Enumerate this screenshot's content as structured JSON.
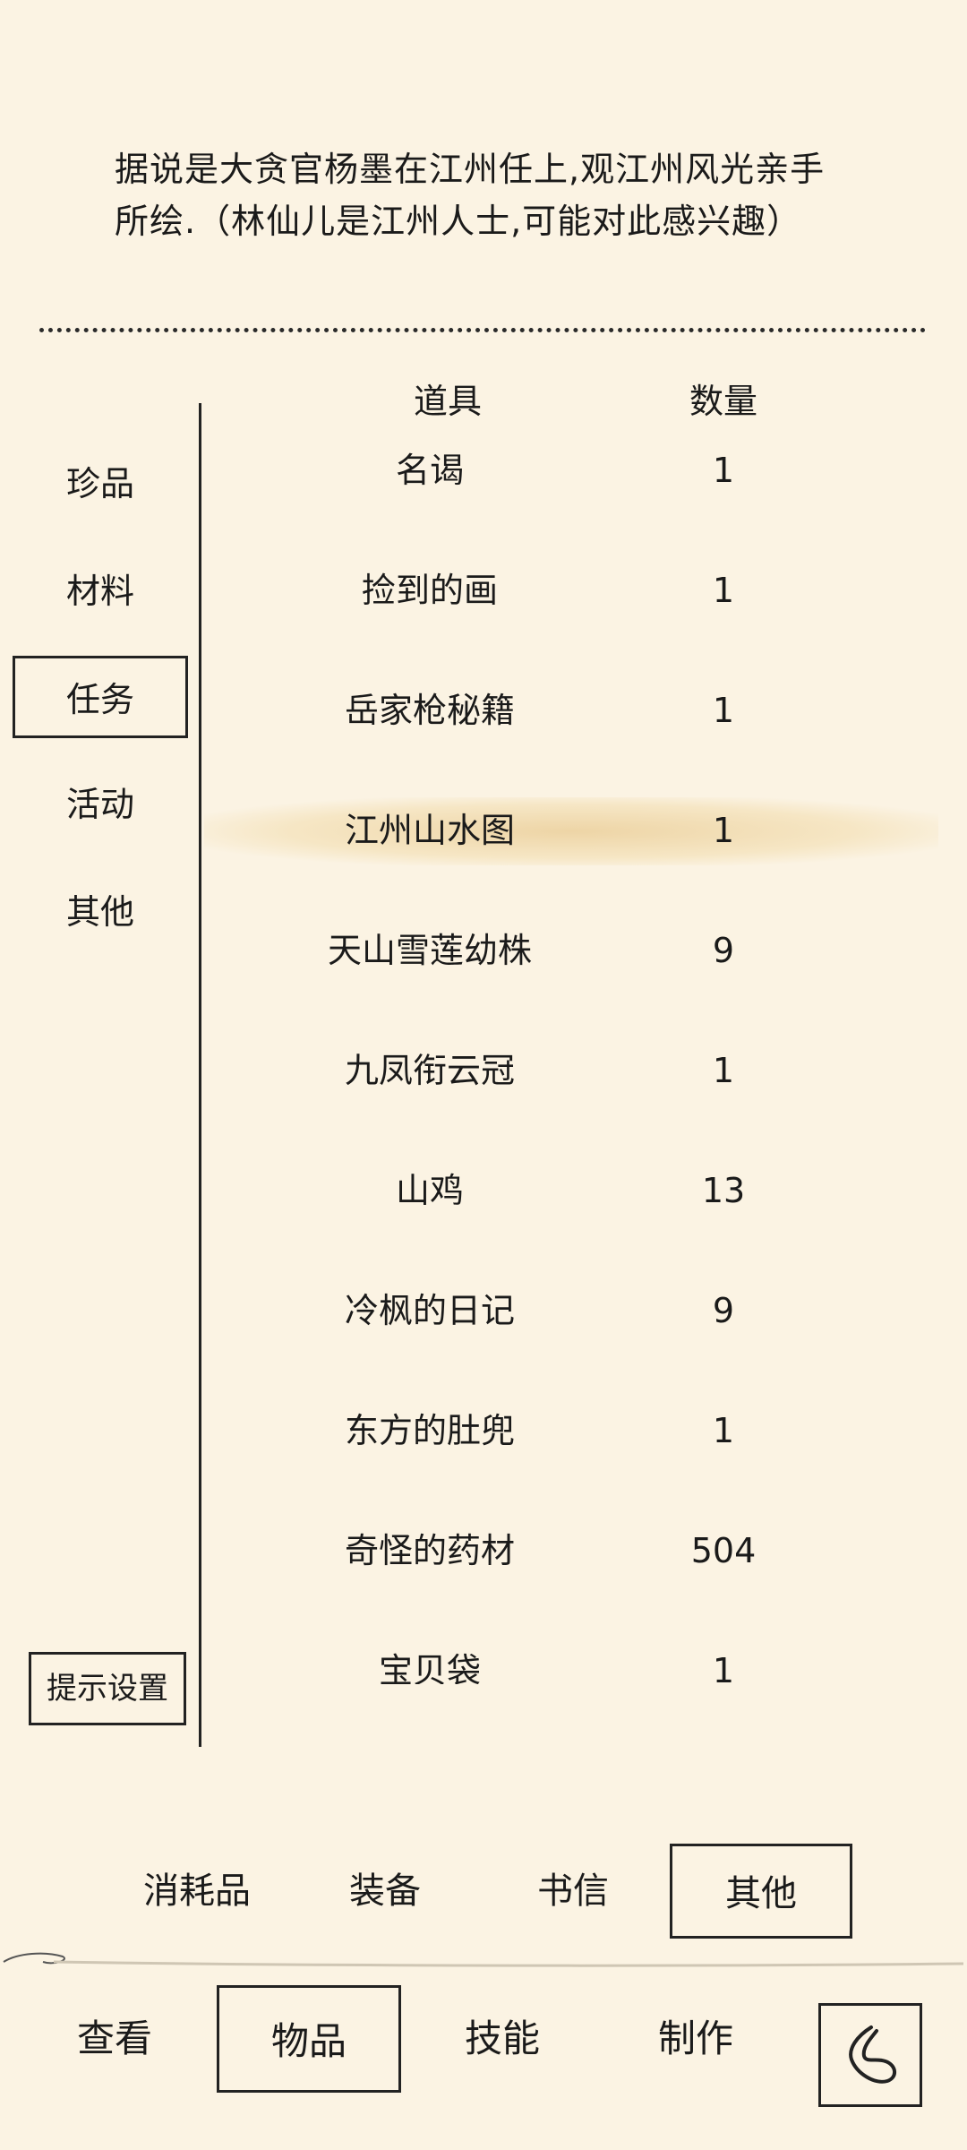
{
  "description": {
    "line1": "据说是大贪官杨墨在江州任上,观江州风光亲手",
    "line2": "所绘.（林仙儿是江州人士,可能对此感兴趣）"
  },
  "sidebar": {
    "items": [
      {
        "label": "珍品",
        "selected": false
      },
      {
        "label": "材料",
        "selected": false
      },
      {
        "label": "任务",
        "selected": true
      },
      {
        "label": "活动",
        "selected": false
      },
      {
        "label": "其他",
        "selected": false
      }
    ],
    "hint_settings_label": "提示设置"
  },
  "table": {
    "header_item": "道具",
    "header_qty": "数量",
    "rows": [
      {
        "name": "名谒",
        "qty": "1"
      },
      {
        "name": "捡到的画",
        "qty": "1"
      },
      {
        "name": "岳家枪秘籍",
        "qty": "1"
      },
      {
        "name": "江州山水图",
        "qty": "1",
        "highlighted": true
      },
      {
        "name": "天山雪莲幼株",
        "qty": "9"
      },
      {
        "name": "九凤衔云冠",
        "qty": "1"
      },
      {
        "name": "山鸡",
        "qty": "13"
      },
      {
        "name": "冷枫的日记",
        "qty": "9"
      },
      {
        "name": "东方的肚兜",
        "qty": "1"
      },
      {
        "name": "奇怪的药材",
        "qty": "504"
      },
      {
        "name": "宝贝袋",
        "qty": "1"
      }
    ]
  },
  "category_tabs": [
    {
      "label": "消耗品",
      "selected": false
    },
    {
      "label": "装备",
      "selected": false
    },
    {
      "label": "书信",
      "selected": false
    },
    {
      "label": "其他",
      "selected": true
    }
  ],
  "bottom_nav": [
    {
      "label": "查看",
      "selected": false
    },
    {
      "label": "物品",
      "selected": true
    },
    {
      "label": "技能",
      "selected": false
    },
    {
      "label": "制作",
      "selected": false
    }
  ],
  "icons": {
    "back": "back-icon"
  },
  "colors": {
    "background": "#fbf3e3",
    "ink": "#1a1a1a",
    "highlight": "#e8c88c"
  }
}
